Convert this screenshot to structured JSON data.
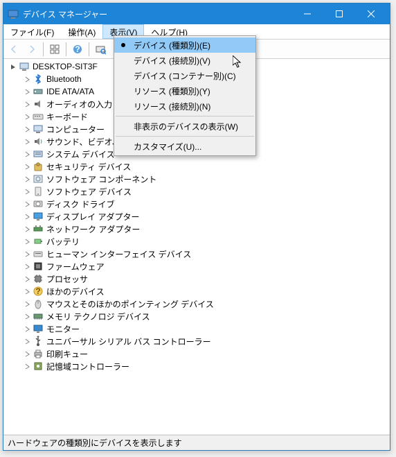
{
  "window": {
    "title": "デバイス マネージャー",
    "min_tooltip": "最小化",
    "max_tooltip": "最大化",
    "close_tooltip": "閉じる"
  },
  "menubar": {
    "file": "ファイル(F)",
    "action": "操作(A)",
    "view": "表示(V)",
    "help": "ヘルプ(H)"
  },
  "view_menu": {
    "devices_by_type": "デバイス (種類別)(E)",
    "devices_by_connection": "デバイス (接続別)(V)",
    "devices_by_container": "デバイス (コンテナー別)(C)",
    "resources_by_type": "リソース (種類別)(Y)",
    "resources_by_connection": "リソース (接続別)(N)",
    "show_hidden": "非表示のデバイスの表示(W)",
    "customize": "カスタマイズ(U)..."
  },
  "tree": {
    "root": "DESKTOP-SIT3F",
    "items": [
      {
        "label": "Bluetooth",
        "icon": "bluetooth"
      },
      {
        "label": "IDE ATA/ATA",
        "icon": "ide"
      },
      {
        "label": "オーディオの入力",
        "icon": "audio"
      },
      {
        "label": "キーボード",
        "icon": "keyboard"
      },
      {
        "label": "コンピューター",
        "icon": "computer"
      },
      {
        "label": "サウンド、ビデオ、",
        "icon": "sound"
      },
      {
        "label": "システム デバイス",
        "icon": "system"
      },
      {
        "label": "セキュリティ デバイス",
        "icon": "security"
      },
      {
        "label": "ソフトウェア コンポーネント",
        "icon": "swcomp"
      },
      {
        "label": "ソフトウェア デバイス",
        "icon": "swdev"
      },
      {
        "label": "ディスク ドライブ",
        "icon": "disk"
      },
      {
        "label": "ディスプレイ アダプター",
        "icon": "display"
      },
      {
        "label": "ネットワーク アダプター",
        "icon": "network"
      },
      {
        "label": "バッテリ",
        "icon": "battery"
      },
      {
        "label": "ヒューマン インターフェイス デバイス",
        "icon": "hid"
      },
      {
        "label": "ファームウェア",
        "icon": "firmware"
      },
      {
        "label": "プロセッサ",
        "icon": "cpu"
      },
      {
        "label": "ほかのデバイス",
        "icon": "other"
      },
      {
        "label": "マウスとそのほかのポインティング デバイス",
        "icon": "mouse"
      },
      {
        "label": "メモリ テクノロジ デバイス",
        "icon": "memory"
      },
      {
        "label": "モニター",
        "icon": "monitor"
      },
      {
        "label": "ユニバーサル シリアル バス コントローラー",
        "icon": "usb"
      },
      {
        "label": "印刷キュー",
        "icon": "printer"
      },
      {
        "label": "記憶域コントローラー",
        "icon": "storage"
      }
    ]
  },
  "statusbar": {
    "text": "ハードウェアの種類別にデバイスを表示します"
  }
}
